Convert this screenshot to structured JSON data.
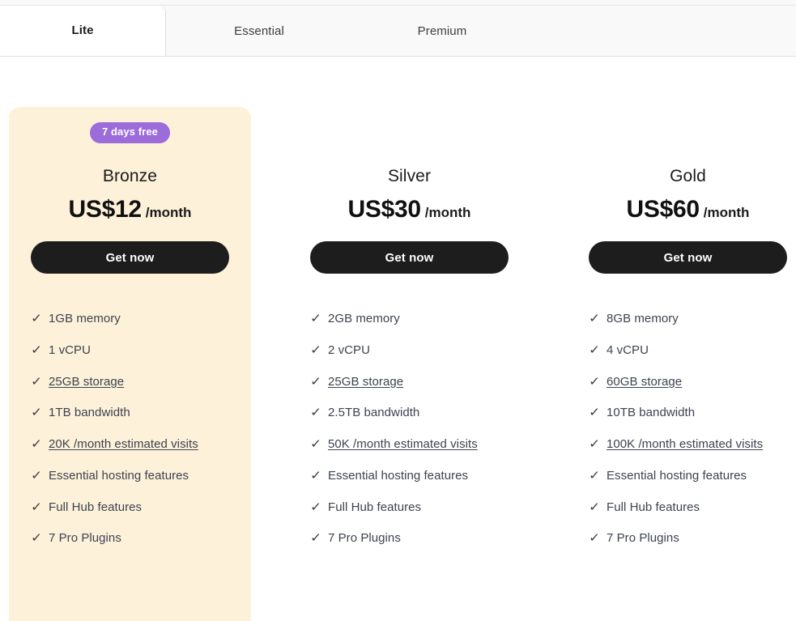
{
  "tabs": [
    {
      "id": "lite",
      "label": "Lite",
      "active": true
    },
    {
      "id": "essential",
      "label": "Essential",
      "active": false
    },
    {
      "id": "premium",
      "label": "Premium",
      "active": false
    }
  ],
  "colors": {
    "highlight_bg": "#fdf1d9",
    "badge_bg": "#9c6cdb",
    "cta_bg": "#1d1d1d",
    "tabbar_bg": "#f9f9f9",
    "feature_text": "#3c4350"
  },
  "icons": {
    "check": "✓"
  },
  "plans": [
    {
      "id": "bronze",
      "name": "Bronze",
      "badge": "7 days free",
      "price": "US$12",
      "period": "/month",
      "cta": "Get now",
      "highlight": true,
      "features": [
        {
          "label": "1GB memory",
          "link": false
        },
        {
          "label": "1 vCPU",
          "link": false
        },
        {
          "label": "25GB storage",
          "link": true
        },
        {
          "label": "1TB bandwidth",
          "link": false
        },
        {
          "label": "20K /month estimated visits",
          "link": true
        },
        {
          "label": "Essential hosting features",
          "link": false
        },
        {
          "label": "Full Hub features",
          "link": false
        },
        {
          "label": "7 Pro Plugins",
          "link": false
        }
      ]
    },
    {
      "id": "silver",
      "name": "Silver",
      "badge": "",
      "price": "US$30",
      "period": "/month",
      "cta": "Get now",
      "highlight": false,
      "features": [
        {
          "label": "2GB memory",
          "link": false
        },
        {
          "label": "2 vCPU",
          "link": false
        },
        {
          "label": "25GB storage",
          "link": true
        },
        {
          "label": "2.5TB bandwidth",
          "link": false
        },
        {
          "label": "50K /month estimated visits",
          "link": true
        },
        {
          "label": "Essential hosting features",
          "link": false
        },
        {
          "label": "Full Hub features",
          "link": false
        },
        {
          "label": "7 Pro Plugins",
          "link": false
        }
      ]
    },
    {
      "id": "gold",
      "name": "Gold",
      "badge": "",
      "price": "US$60",
      "period": "/month",
      "cta": "Get now",
      "highlight": false,
      "features": [
        {
          "label": "8GB memory",
          "link": false
        },
        {
          "label": "4 vCPU",
          "link": false
        },
        {
          "label": "60GB storage",
          "link": true
        },
        {
          "label": "10TB bandwidth",
          "link": false
        },
        {
          "label": "100K /month estimated visits",
          "link": true
        },
        {
          "label": "Essential hosting features",
          "link": false
        },
        {
          "label": "Full Hub features",
          "link": false
        },
        {
          "label": "7 Pro Plugins",
          "link": false
        }
      ]
    }
  ]
}
